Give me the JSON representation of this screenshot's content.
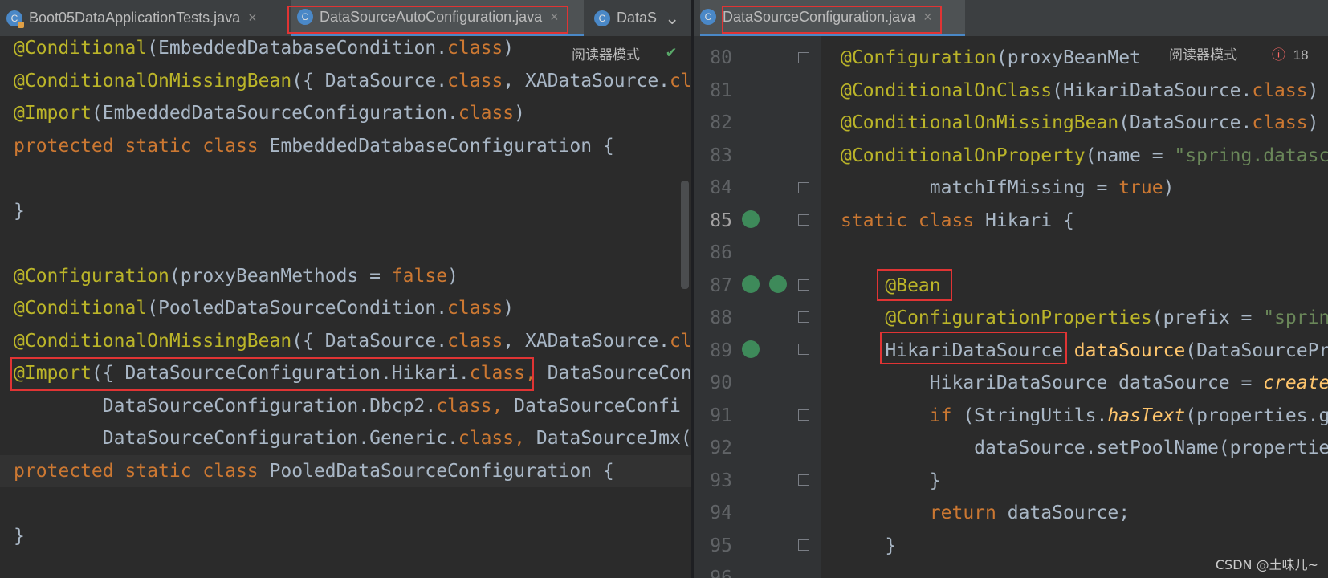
{
  "left": {
    "tabs": [
      {
        "label": "Boot05DataApplicationTests.java",
        "icon": "test-class-icon",
        "close": "×"
      },
      {
        "label": "DataSourceAutoConfiguration.java",
        "icon": "class-icon",
        "close": "×"
      },
      {
        "label": "DataS",
        "icon": "class-icon"
      }
    ],
    "tabs_overflow": "⌄",
    "reader_mode": "阅读器模式",
    "check": "✔",
    "lines": [
      {
        "parts": [
          [
            "ann",
            "@Conditional"
          ],
          [
            "",
            "(EmbeddedDatabaseCondition."
          ],
          [
            "kw",
            "class"
          ],
          [
            "",
            ")"
          ]
        ]
      },
      {
        "parts": [
          [
            "ann",
            "@ConditionalOnMissingBean"
          ],
          [
            "",
            "({ DataSource."
          ],
          [
            "kw",
            "class"
          ],
          [
            "",
            ", XADataSource."
          ],
          [
            "kw",
            "cl"
          ]
        ]
      },
      {
        "parts": [
          [
            "ann",
            "@Import"
          ],
          [
            "",
            "(EmbeddedDataSourceConfiguration."
          ],
          [
            "kw",
            "class"
          ],
          [
            "",
            ")"
          ]
        ]
      },
      {
        "parts": [
          [
            "kw",
            "protected static class "
          ],
          [
            "",
            "EmbeddedDatabaseConfiguration {"
          ]
        ]
      },
      {
        "parts": []
      },
      {
        "parts": [
          [
            "",
            "}"
          ]
        ]
      },
      {
        "parts": []
      },
      {
        "parts": [
          [
            "ann",
            "@Configuration"
          ],
          [
            "",
            "(proxyBeanMethods = "
          ],
          [
            "kw",
            "false"
          ],
          [
            "",
            ")"
          ]
        ]
      },
      {
        "parts": [
          [
            "ann",
            "@Conditional"
          ],
          [
            "",
            "(PooledDataSourceCondition."
          ],
          [
            "kw",
            "class"
          ],
          [
            "",
            ")"
          ]
        ]
      },
      {
        "parts": [
          [
            "ann",
            "@ConditionalOnMissingBean"
          ],
          [
            "",
            "({ DataSource."
          ],
          [
            "kw",
            "class"
          ],
          [
            "",
            ", XADataSource."
          ],
          [
            "kw",
            "cl"
          ]
        ]
      },
      {
        "parts": [
          [
            "ann",
            "@Import"
          ],
          [
            "",
            "({ DataSourceConfiguration.Hikari."
          ],
          [
            "kw",
            "class"
          ],
          [
            "kw",
            ","
          ],
          [
            "",
            " DataSourceCon"
          ]
        ]
      },
      {
        "parts": [
          [
            "",
            "        DataSourceConfiguration.Dbcp2."
          ],
          [
            "kw",
            "class"
          ],
          [
            "kw",
            ","
          ],
          [
            "",
            " DataSourceConfi"
          ]
        ]
      },
      {
        "parts": [
          [
            "",
            "        DataSourceConfiguration.Generic."
          ],
          [
            "kw",
            "class"
          ],
          [
            "kw",
            ","
          ],
          [
            "",
            " DataSourceJmx("
          ]
        ]
      },
      {
        "parts": [
          [
            "kw",
            "protected static class "
          ],
          [
            "",
            "PooledDataSourceConfiguration {"
          ]
        ]
      },
      {
        "parts": []
      },
      {
        "parts": [
          [
            "",
            "}"
          ]
        ]
      }
    ]
  },
  "right": {
    "tab": {
      "label": "DataSourceConfiguration.java",
      "icon": "class-icon",
      "close": "×"
    },
    "reader_mode": "阅读器模式",
    "error_count": "18",
    "lines": [
      {
        "num": "80",
        "parts": [
          [
            "ann",
            "@Configuration"
          ],
          [
            "",
            "(proxyBeanMet"
          ]
        ]
      },
      {
        "num": "81",
        "parts": [
          [
            "ann",
            "@ConditionalOnClass"
          ],
          [
            "",
            "(HikariDataSource."
          ],
          [
            "kw",
            "class"
          ],
          [
            "",
            ")"
          ]
        ]
      },
      {
        "num": "82",
        "parts": [
          [
            "ann",
            "@ConditionalOnMissingBean"
          ],
          [
            "",
            "(DataSource."
          ],
          [
            "kw",
            "class"
          ],
          [
            "",
            ")"
          ]
        ]
      },
      {
        "num": "83",
        "parts": [
          [
            "ann",
            "@ConditionalOnProperty"
          ],
          [
            "",
            "(name = "
          ],
          [
            "str",
            "\"spring.datasc"
          ]
        ]
      },
      {
        "num": "84",
        "parts": [
          [
            "",
            "        matchIfMissing = "
          ],
          [
            "kw",
            "true"
          ],
          [
            "",
            ")"
          ]
        ]
      },
      {
        "num": "85",
        "parts": [
          [
            "kw",
            "static class "
          ],
          [
            "",
            "Hikari {"
          ]
        ]
      },
      {
        "num": "86",
        "parts": []
      },
      {
        "num": "87",
        "parts": [
          [
            "",
            "    "
          ],
          [
            "ann",
            "@Bean"
          ]
        ]
      },
      {
        "num": "88",
        "parts": [
          [
            "",
            "    "
          ],
          [
            "ann",
            "@ConfigurationProperties"
          ],
          [
            "",
            "(prefix = "
          ],
          [
            "str",
            "\"sprin"
          ]
        ]
      },
      {
        "num": "89",
        "parts": [
          [
            "",
            "    HikariDataSource "
          ],
          [
            "mth",
            "dataSource"
          ],
          [
            "",
            "(DataSourcePr"
          ]
        ]
      },
      {
        "num": "90",
        "parts": [
          [
            "",
            "        HikariDataSource dataSource = "
          ],
          [
            "ital",
            "create"
          ]
        ]
      },
      {
        "num": "91",
        "parts": [
          [
            "",
            "        "
          ],
          [
            "kw",
            "if "
          ],
          [
            "",
            "(StringUtils."
          ],
          [
            "ital",
            "hasText"
          ],
          [
            "",
            "(properties.g"
          ]
        ]
      },
      {
        "num": "92",
        "parts": [
          [
            "",
            "            dataSource.setPoolName(propertie"
          ]
        ]
      },
      {
        "num": "93",
        "parts": [
          [
            "",
            "        }"
          ]
        ]
      },
      {
        "num": "94",
        "parts": [
          [
            "",
            "        "
          ],
          [
            "kw",
            "return "
          ],
          [
            "",
            "dataSource;"
          ]
        ]
      },
      {
        "num": "95",
        "parts": [
          [
            "",
            "    }"
          ]
        ]
      },
      {
        "num": "96",
        "parts": []
      }
    ]
  },
  "watermark": "CSDN @土味儿~"
}
